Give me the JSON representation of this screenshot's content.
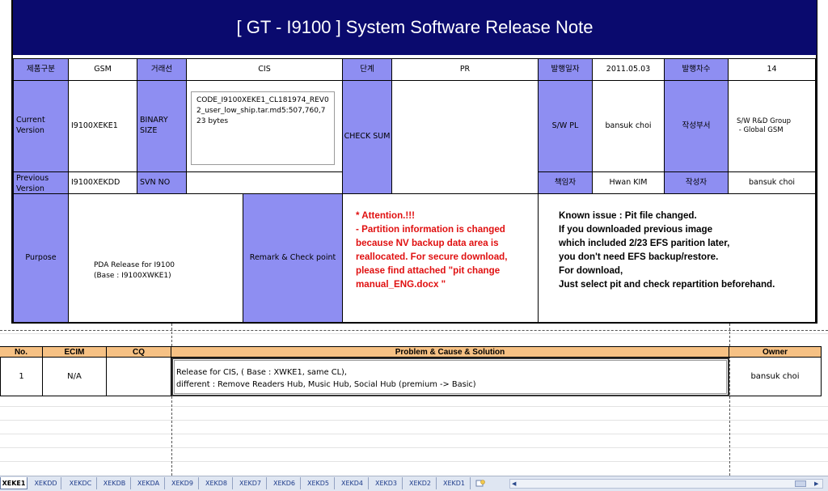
{
  "title": "[ GT  - I9100 ] System Software Release Note",
  "header_row": {
    "product_type_label": "제품구분",
    "product_type_value": "GSM",
    "buyer_label": "거래선",
    "buyer_value": "CIS",
    "stage_label": "단계",
    "stage_value": "PR",
    "issue_date_label": "발행일자",
    "issue_date_value": "2011.05.03",
    "issue_no_label": "발행차수",
    "issue_no_value": "14"
  },
  "version_block": {
    "current_label": "Current Version",
    "current_value": "I9100XEKE1",
    "binary_size_label": "BINARY SIZE",
    "binary_size_value": "CODE_I9100XEKE1_CL181974_REV02_user_low_ship.tar.md5:507,760,723 bytes",
    "checksum_label": "CHECK SUM",
    "swpl_label": "S/W PL",
    "swpl_value": "bansuk choi",
    "dept_label": "작성부서",
    "dept_value_line1": "S/W R&D Group",
    "dept_value_line2": " - Global GSM",
    "previous_label": "Previous Version",
    "previous_value": "I9100XEKDD",
    "svn_label": "SVN NO",
    "owner_label": "책임자",
    "owner_value": "Hwan KIM",
    "author_label": "작성자",
    "author_value": "bansuk choi"
  },
  "purpose_block": {
    "purpose_label": "Purpose",
    "purpose_line1": "PDA Release for I9100",
    "purpose_line2": "(Base : I9100XWKE1)",
    "remark_label": "Remark & Check point",
    "attention_lines": [
      "*  Attention.!!!",
      "-  Partition information is changed",
      "because  NV backup data area  is",
      "reallocated.  For secure download,",
      "please find attached \"pit change",
      "manual_ENG.docx \""
    ],
    "known_lines": [
      "Known issue :  Pit file changed.",
      "If you downloaded previous image",
      "which included 2/23 EFS parition later,",
      "you don't need EFS backup/restore.",
      "For download,",
      "Just select pit and check repartition beforehand."
    ]
  },
  "issues_table": {
    "headers": {
      "no": "No.",
      "ecim": "ECIM",
      "cq": "CQ",
      "problem": "Problem & Cause & Solution",
      "owner": "Owner"
    },
    "rows": [
      {
        "no": "1",
        "ecim": "N/A",
        "cq": "",
        "solution_line1": "Release for CIS, ( Base : XWKE1, same CL),",
        "solution_line2": "different : Remove Readers Hub, Music Hub, Social Hub (premium -> Basic)",
        "owner": "bansuk choi"
      }
    ]
  },
  "sheet_tabs": [
    "XEKE1",
    "XEKDD",
    "XEKDC",
    "XEKDB",
    "XEKDA",
    "XEKD9",
    "XEKD8",
    "XEKD7",
    "XEKD6",
    "XEKD5",
    "XEKD4",
    "XEKD3",
    "XEKD2",
    "XEKD1"
  ],
  "colors": {
    "title_bg": "#0a0a6e",
    "label_bg": "#8e8ef2",
    "attention": "#e01010",
    "table_header": "#f6c184"
  }
}
